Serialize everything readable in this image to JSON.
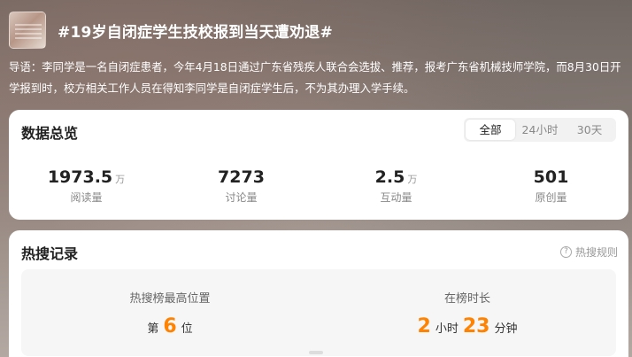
{
  "header": {
    "title": "#19岁自闭症学生技校报到当天遭劝退#",
    "thumbnail_icon": "news-thumbnail-icon"
  },
  "guide": {
    "text": "导语：李同学是一名自闭症患者，今年4月18日通过广东省残疾人联合会选拔、推荐，报考广东省机械技师学院，而8月30日开学报到时，校方相关工作人员在得知李同学是自闭症学生后，不为其办理入学手续。"
  },
  "overview": {
    "title": "数据总览",
    "tabs": [
      "全部",
      "24小时",
      "30天"
    ],
    "active_tab": "全部",
    "stats": [
      {
        "value": "1973.5",
        "unit": "万",
        "label": "阅读量"
      },
      {
        "value": "7273",
        "unit": "",
        "label": "讨论量"
      },
      {
        "value": "2.5",
        "unit": "万",
        "label": "互动量"
      },
      {
        "value": "501",
        "unit": "",
        "label": "原创量"
      }
    ]
  },
  "hot_record": {
    "title": "热搜记录",
    "help_label": "热搜规则",
    "help_icon": "question-circle-icon",
    "highest_position": {
      "label": "热搜榜最高位置",
      "prefix": "第",
      "value": "6",
      "suffix": "位"
    },
    "duration": {
      "label": "在榜时长",
      "hours": "2",
      "hours_unit": "小时",
      "minutes": "23",
      "minutes_unit": "分钟"
    }
  },
  "colors": {
    "accent": "#ff8200",
    "card": "#ffffff",
    "tab_bg": "#f2f2f2"
  }
}
